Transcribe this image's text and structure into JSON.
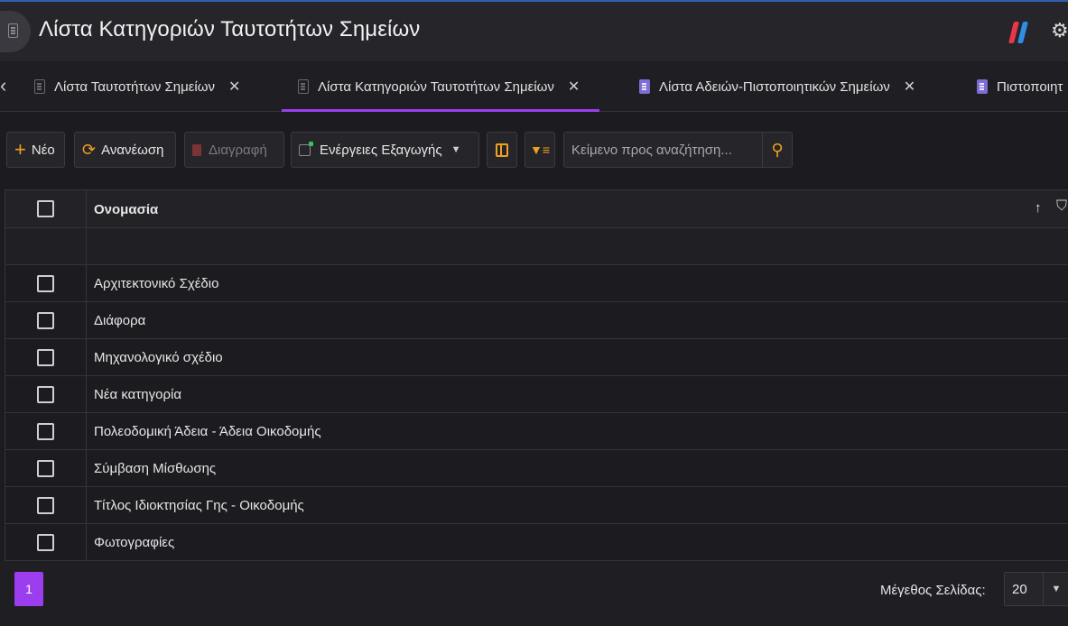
{
  "window": {
    "title": "Λίστα Κατηγοριών Ταυτοτήτων Σημείων"
  },
  "tabs": [
    {
      "label": "Λίστα Ταυτοτήτων Σημείων",
      "active": false
    },
    {
      "label": "Λίστα Κατηγοριών Ταυτοτήτων Σημείων",
      "active": true
    },
    {
      "label": "Λίστα Αδειών-Πιστοποιητικών Σημείων",
      "active": false
    },
    {
      "label": "Πιστοποιητ",
      "active": false
    }
  ],
  "toolbar": {
    "new_label": "Νέο",
    "refresh_label": "Ανανέωση",
    "delete_label": "Διαγραφή",
    "export_label": "Ενέργειες Εξαγωγής",
    "search_placeholder": "Κείμενο προς αναζήτηση..."
  },
  "table": {
    "header": {
      "name": "Ονομασία"
    },
    "rows": [
      "Αρχιτεκτονικό Σχέδιο",
      "Διάφορα",
      "Μηχανολογικό σχέδιο",
      "Νέα κατηγορία",
      "Πολεοδομική Άδεια - Άδεια Οικοδομής",
      "Σύμβαση Μίσθωσης",
      "Τίτλος Ιδιοκτησίας Γης - Οικοδομής",
      "Φωτογραφίες"
    ]
  },
  "pager": {
    "current_page": "1",
    "page_size_label": "Μέγεθος Σελίδας:",
    "page_size": "20"
  },
  "colors": {
    "accent": "#9c3ef0",
    "icon_orange": "#f0a020",
    "background": "#1c1c20"
  }
}
